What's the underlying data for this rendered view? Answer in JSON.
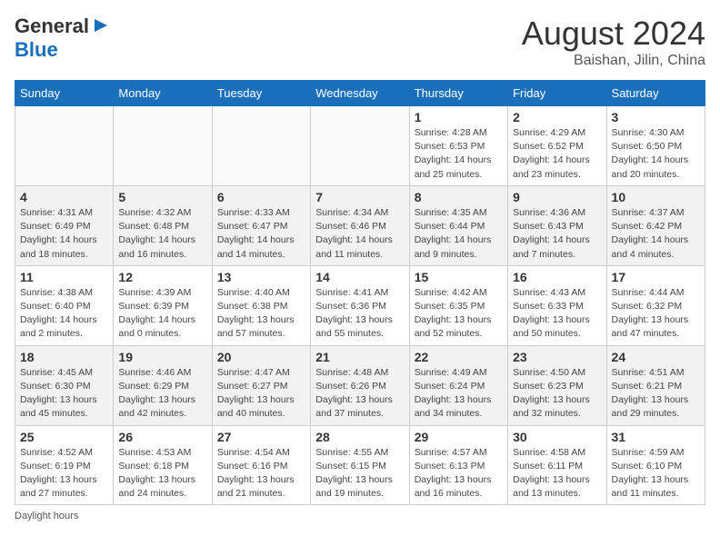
{
  "header": {
    "logo_general": "General",
    "logo_blue": "Blue",
    "month_year": "August 2024",
    "location": "Baishan, Jilin, China"
  },
  "days_of_week": [
    "Sunday",
    "Monday",
    "Tuesday",
    "Wednesday",
    "Thursday",
    "Friday",
    "Saturday"
  ],
  "footer": {
    "daylight_label": "Daylight hours"
  },
  "weeks": [
    {
      "days": [
        {
          "num": "",
          "info": ""
        },
        {
          "num": "",
          "info": ""
        },
        {
          "num": "",
          "info": ""
        },
        {
          "num": "",
          "info": ""
        },
        {
          "num": "1",
          "info": "Sunrise: 4:28 AM\nSunset: 6:53 PM\nDaylight: 14 hours\nand 25 minutes."
        },
        {
          "num": "2",
          "info": "Sunrise: 4:29 AM\nSunset: 6:52 PM\nDaylight: 14 hours\nand 23 minutes."
        },
        {
          "num": "3",
          "info": "Sunrise: 4:30 AM\nSunset: 6:50 PM\nDaylight: 14 hours\nand 20 minutes."
        }
      ]
    },
    {
      "days": [
        {
          "num": "4",
          "info": "Sunrise: 4:31 AM\nSunset: 6:49 PM\nDaylight: 14 hours\nand 18 minutes."
        },
        {
          "num": "5",
          "info": "Sunrise: 4:32 AM\nSunset: 6:48 PM\nDaylight: 14 hours\nand 16 minutes."
        },
        {
          "num": "6",
          "info": "Sunrise: 4:33 AM\nSunset: 6:47 PM\nDaylight: 14 hours\nand 14 minutes."
        },
        {
          "num": "7",
          "info": "Sunrise: 4:34 AM\nSunset: 6:46 PM\nDaylight: 14 hours\nand 11 minutes."
        },
        {
          "num": "8",
          "info": "Sunrise: 4:35 AM\nSunset: 6:44 PM\nDaylight: 14 hours\nand 9 minutes."
        },
        {
          "num": "9",
          "info": "Sunrise: 4:36 AM\nSunset: 6:43 PM\nDaylight: 14 hours\nand 7 minutes."
        },
        {
          "num": "10",
          "info": "Sunrise: 4:37 AM\nSunset: 6:42 PM\nDaylight: 14 hours\nand 4 minutes."
        }
      ]
    },
    {
      "days": [
        {
          "num": "11",
          "info": "Sunrise: 4:38 AM\nSunset: 6:40 PM\nDaylight: 14 hours\nand 2 minutes."
        },
        {
          "num": "12",
          "info": "Sunrise: 4:39 AM\nSunset: 6:39 PM\nDaylight: 14 hours\nand 0 minutes."
        },
        {
          "num": "13",
          "info": "Sunrise: 4:40 AM\nSunset: 6:38 PM\nDaylight: 13 hours\nand 57 minutes."
        },
        {
          "num": "14",
          "info": "Sunrise: 4:41 AM\nSunset: 6:36 PM\nDaylight: 13 hours\nand 55 minutes."
        },
        {
          "num": "15",
          "info": "Sunrise: 4:42 AM\nSunset: 6:35 PM\nDaylight: 13 hours\nand 52 minutes."
        },
        {
          "num": "16",
          "info": "Sunrise: 4:43 AM\nSunset: 6:33 PM\nDaylight: 13 hours\nand 50 minutes."
        },
        {
          "num": "17",
          "info": "Sunrise: 4:44 AM\nSunset: 6:32 PM\nDaylight: 13 hours\nand 47 minutes."
        }
      ]
    },
    {
      "days": [
        {
          "num": "18",
          "info": "Sunrise: 4:45 AM\nSunset: 6:30 PM\nDaylight: 13 hours\nand 45 minutes."
        },
        {
          "num": "19",
          "info": "Sunrise: 4:46 AM\nSunset: 6:29 PM\nDaylight: 13 hours\nand 42 minutes."
        },
        {
          "num": "20",
          "info": "Sunrise: 4:47 AM\nSunset: 6:27 PM\nDaylight: 13 hours\nand 40 minutes."
        },
        {
          "num": "21",
          "info": "Sunrise: 4:48 AM\nSunset: 6:26 PM\nDaylight: 13 hours\nand 37 minutes."
        },
        {
          "num": "22",
          "info": "Sunrise: 4:49 AM\nSunset: 6:24 PM\nDaylight: 13 hours\nand 34 minutes."
        },
        {
          "num": "23",
          "info": "Sunrise: 4:50 AM\nSunset: 6:23 PM\nDaylight: 13 hours\nand 32 minutes."
        },
        {
          "num": "24",
          "info": "Sunrise: 4:51 AM\nSunset: 6:21 PM\nDaylight: 13 hours\nand 29 minutes."
        }
      ]
    },
    {
      "days": [
        {
          "num": "25",
          "info": "Sunrise: 4:52 AM\nSunset: 6:19 PM\nDaylight: 13 hours\nand 27 minutes."
        },
        {
          "num": "26",
          "info": "Sunrise: 4:53 AM\nSunset: 6:18 PM\nDaylight: 13 hours\nand 24 minutes."
        },
        {
          "num": "27",
          "info": "Sunrise: 4:54 AM\nSunset: 6:16 PM\nDaylight: 13 hours\nand 21 minutes."
        },
        {
          "num": "28",
          "info": "Sunrise: 4:55 AM\nSunset: 6:15 PM\nDaylight: 13 hours\nand 19 minutes."
        },
        {
          "num": "29",
          "info": "Sunrise: 4:57 AM\nSunset: 6:13 PM\nDaylight: 13 hours\nand 16 minutes."
        },
        {
          "num": "30",
          "info": "Sunrise: 4:58 AM\nSunset: 6:11 PM\nDaylight: 13 hours\nand 13 minutes."
        },
        {
          "num": "31",
          "info": "Sunrise: 4:59 AM\nSunset: 6:10 PM\nDaylight: 13 hours\nand 11 minutes."
        }
      ]
    }
  ]
}
